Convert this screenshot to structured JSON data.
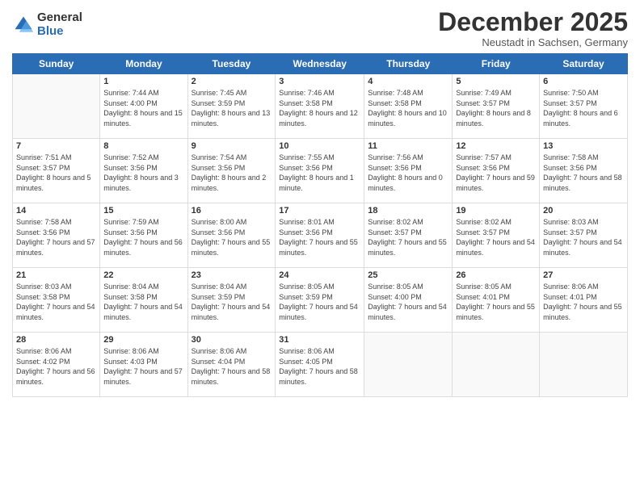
{
  "logo": {
    "general": "General",
    "blue": "Blue"
  },
  "title": "December 2025",
  "location": "Neustadt in Sachsen, Germany",
  "header_days": [
    "Sunday",
    "Monday",
    "Tuesday",
    "Wednesday",
    "Thursday",
    "Friday",
    "Saturday"
  ],
  "weeks": [
    [
      {
        "day": "",
        "info": ""
      },
      {
        "day": "1",
        "info": "Sunrise: 7:44 AM\nSunset: 4:00 PM\nDaylight: 8 hours\nand 15 minutes."
      },
      {
        "day": "2",
        "info": "Sunrise: 7:45 AM\nSunset: 3:59 PM\nDaylight: 8 hours\nand 13 minutes."
      },
      {
        "day": "3",
        "info": "Sunrise: 7:46 AM\nSunset: 3:58 PM\nDaylight: 8 hours\nand 12 minutes."
      },
      {
        "day": "4",
        "info": "Sunrise: 7:48 AM\nSunset: 3:58 PM\nDaylight: 8 hours\nand 10 minutes."
      },
      {
        "day": "5",
        "info": "Sunrise: 7:49 AM\nSunset: 3:57 PM\nDaylight: 8 hours\nand 8 minutes."
      },
      {
        "day": "6",
        "info": "Sunrise: 7:50 AM\nSunset: 3:57 PM\nDaylight: 8 hours\nand 6 minutes."
      }
    ],
    [
      {
        "day": "7",
        "info": "Sunrise: 7:51 AM\nSunset: 3:57 PM\nDaylight: 8 hours\nand 5 minutes."
      },
      {
        "day": "8",
        "info": "Sunrise: 7:52 AM\nSunset: 3:56 PM\nDaylight: 8 hours\nand 3 minutes."
      },
      {
        "day": "9",
        "info": "Sunrise: 7:54 AM\nSunset: 3:56 PM\nDaylight: 8 hours\nand 2 minutes."
      },
      {
        "day": "10",
        "info": "Sunrise: 7:55 AM\nSunset: 3:56 PM\nDaylight: 8 hours\nand 1 minute."
      },
      {
        "day": "11",
        "info": "Sunrise: 7:56 AM\nSunset: 3:56 PM\nDaylight: 8 hours\nand 0 minutes."
      },
      {
        "day": "12",
        "info": "Sunrise: 7:57 AM\nSunset: 3:56 PM\nDaylight: 7 hours\nand 59 minutes."
      },
      {
        "day": "13",
        "info": "Sunrise: 7:58 AM\nSunset: 3:56 PM\nDaylight: 7 hours\nand 58 minutes."
      }
    ],
    [
      {
        "day": "14",
        "info": "Sunrise: 7:58 AM\nSunset: 3:56 PM\nDaylight: 7 hours\nand 57 minutes."
      },
      {
        "day": "15",
        "info": "Sunrise: 7:59 AM\nSunset: 3:56 PM\nDaylight: 7 hours\nand 56 minutes."
      },
      {
        "day": "16",
        "info": "Sunrise: 8:00 AM\nSunset: 3:56 PM\nDaylight: 7 hours\nand 55 minutes."
      },
      {
        "day": "17",
        "info": "Sunrise: 8:01 AM\nSunset: 3:56 PM\nDaylight: 7 hours\nand 55 minutes."
      },
      {
        "day": "18",
        "info": "Sunrise: 8:02 AM\nSunset: 3:57 PM\nDaylight: 7 hours\nand 55 minutes."
      },
      {
        "day": "19",
        "info": "Sunrise: 8:02 AM\nSunset: 3:57 PM\nDaylight: 7 hours\nand 54 minutes."
      },
      {
        "day": "20",
        "info": "Sunrise: 8:03 AM\nSunset: 3:57 PM\nDaylight: 7 hours\nand 54 minutes."
      }
    ],
    [
      {
        "day": "21",
        "info": "Sunrise: 8:03 AM\nSunset: 3:58 PM\nDaylight: 7 hours\nand 54 minutes."
      },
      {
        "day": "22",
        "info": "Sunrise: 8:04 AM\nSunset: 3:58 PM\nDaylight: 7 hours\nand 54 minutes."
      },
      {
        "day": "23",
        "info": "Sunrise: 8:04 AM\nSunset: 3:59 PM\nDaylight: 7 hours\nand 54 minutes."
      },
      {
        "day": "24",
        "info": "Sunrise: 8:05 AM\nSunset: 3:59 PM\nDaylight: 7 hours\nand 54 minutes."
      },
      {
        "day": "25",
        "info": "Sunrise: 8:05 AM\nSunset: 4:00 PM\nDaylight: 7 hours\nand 54 minutes."
      },
      {
        "day": "26",
        "info": "Sunrise: 8:05 AM\nSunset: 4:01 PM\nDaylight: 7 hours\nand 55 minutes."
      },
      {
        "day": "27",
        "info": "Sunrise: 8:06 AM\nSunset: 4:01 PM\nDaylight: 7 hours\nand 55 minutes."
      }
    ],
    [
      {
        "day": "28",
        "info": "Sunrise: 8:06 AM\nSunset: 4:02 PM\nDaylight: 7 hours\nand 56 minutes."
      },
      {
        "day": "29",
        "info": "Sunrise: 8:06 AM\nSunset: 4:03 PM\nDaylight: 7 hours\nand 57 minutes."
      },
      {
        "day": "30",
        "info": "Sunrise: 8:06 AM\nSunset: 4:04 PM\nDaylight: 7 hours\nand 58 minutes."
      },
      {
        "day": "31",
        "info": "Sunrise: 8:06 AM\nSunset: 4:05 PM\nDaylight: 7 hours\nand 58 minutes."
      },
      {
        "day": "",
        "info": ""
      },
      {
        "day": "",
        "info": ""
      },
      {
        "day": "",
        "info": ""
      }
    ]
  ]
}
